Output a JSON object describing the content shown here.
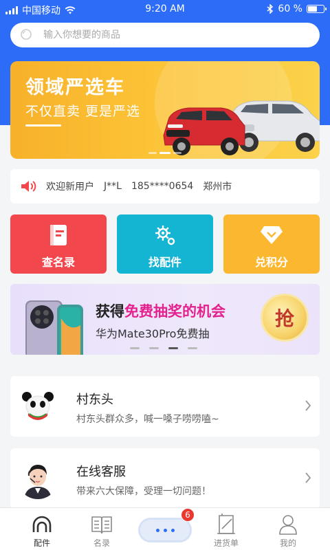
{
  "status_bar": {
    "carrier": "中国移动",
    "time": "9:20 AM",
    "battery_text": "60 %",
    "battery_level": 0.6,
    "icons": [
      "signal-icon",
      "wifi-icon",
      "bluetooth-icon",
      "battery-icon"
    ]
  },
  "search": {
    "placeholder": "输入你想要的商品",
    "icon": "search-icon"
  },
  "banner": {
    "title": "领域严选车",
    "subtitle": "不仅直卖 更是严选",
    "slide_count": 3,
    "active_slide": 2
  },
  "notice": {
    "icon": "speaker-icon",
    "welcome": "欢迎新用户",
    "user": "J**L",
    "phone": "185****0654",
    "city": "郑州市"
  },
  "tiles": [
    {
      "label": "查名录",
      "icon": "book-icon",
      "color": "#f2474c"
    },
    {
      "label": "找配件",
      "icon": "gear-icon",
      "color": "#14b4d3"
    },
    {
      "label": "兑积分",
      "icon": "diamond-icon",
      "color": "#fcb730"
    }
  ],
  "promo": {
    "title_prefix": "获得",
    "title_highlight": "免费抽奖的机会",
    "subtitle": "华为Mate30Pro免费抽",
    "badge": "抢",
    "highlight_color": "#e3228e"
  },
  "cards": [
    {
      "title": "村东头",
      "subtitle": "村东头群众多，喊一嗓子唠唠嗑~",
      "avatar": "panda-avatar"
    },
    {
      "title": "在线客服",
      "subtitle": "带来六大保障，受理一切问题！",
      "avatar": "agent-avatar"
    }
  ],
  "tabbar": {
    "items": [
      {
        "label": "配件",
        "icon": "headset-icon",
        "active": true
      },
      {
        "label": "名录",
        "icon": "book-open-icon",
        "active": false
      },
      {
        "label": "进货单",
        "icon": "receipt-icon",
        "active": false
      },
      {
        "label": "我的",
        "icon": "user-icon",
        "active": false
      }
    ],
    "chat_badge": "6",
    "accent": "#2d6cf6"
  }
}
